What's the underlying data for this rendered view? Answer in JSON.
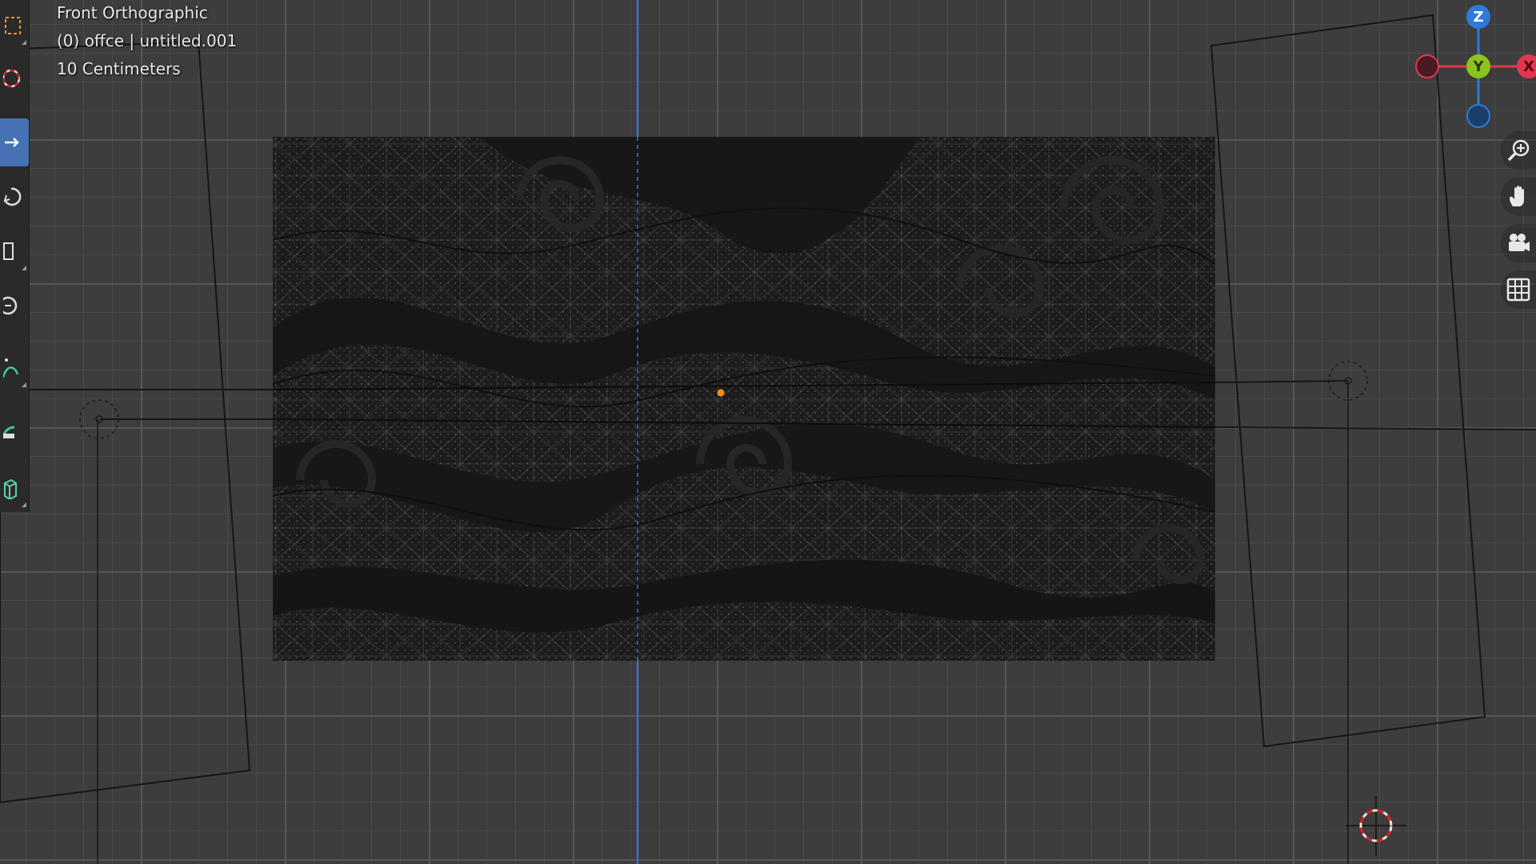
{
  "overlay": {
    "view_name": "Front Orthographic",
    "collection_object": "(0) offce | untitled.001",
    "grid_scale": "10 Centimeters"
  },
  "toolbar": {
    "tools": [
      {
        "icon": "select-box-icon"
      },
      {
        "icon": "cursor-icon"
      },
      {
        "icon": "move-icon",
        "active": true
      },
      {
        "icon": "rotate-icon"
      },
      {
        "icon": "scale-icon"
      },
      {
        "icon": "transform-icon"
      },
      {
        "icon": "annotate-icon"
      },
      {
        "icon": "measure-icon"
      },
      {
        "icon": "add-cube-icon"
      }
    ]
  },
  "gizmo": {
    "z_label": "Z",
    "y_label": "Y",
    "x_label": "X",
    "colors": {
      "x": "#e0394f",
      "y": "#8cc41d",
      "z": "#2d7bd6"
    }
  },
  "nav_buttons": [
    {
      "icon": "zoom-icon"
    },
    {
      "icon": "pan-hand-icon"
    },
    {
      "icon": "camera-view-icon"
    },
    {
      "icon": "ortho-grid-icon"
    }
  ],
  "colors": {
    "background": "#3d3d3d",
    "active_tool": "#4772b3",
    "origin_dot": "#ff8c1a",
    "z_axis_line": "#3b6fc9"
  }
}
